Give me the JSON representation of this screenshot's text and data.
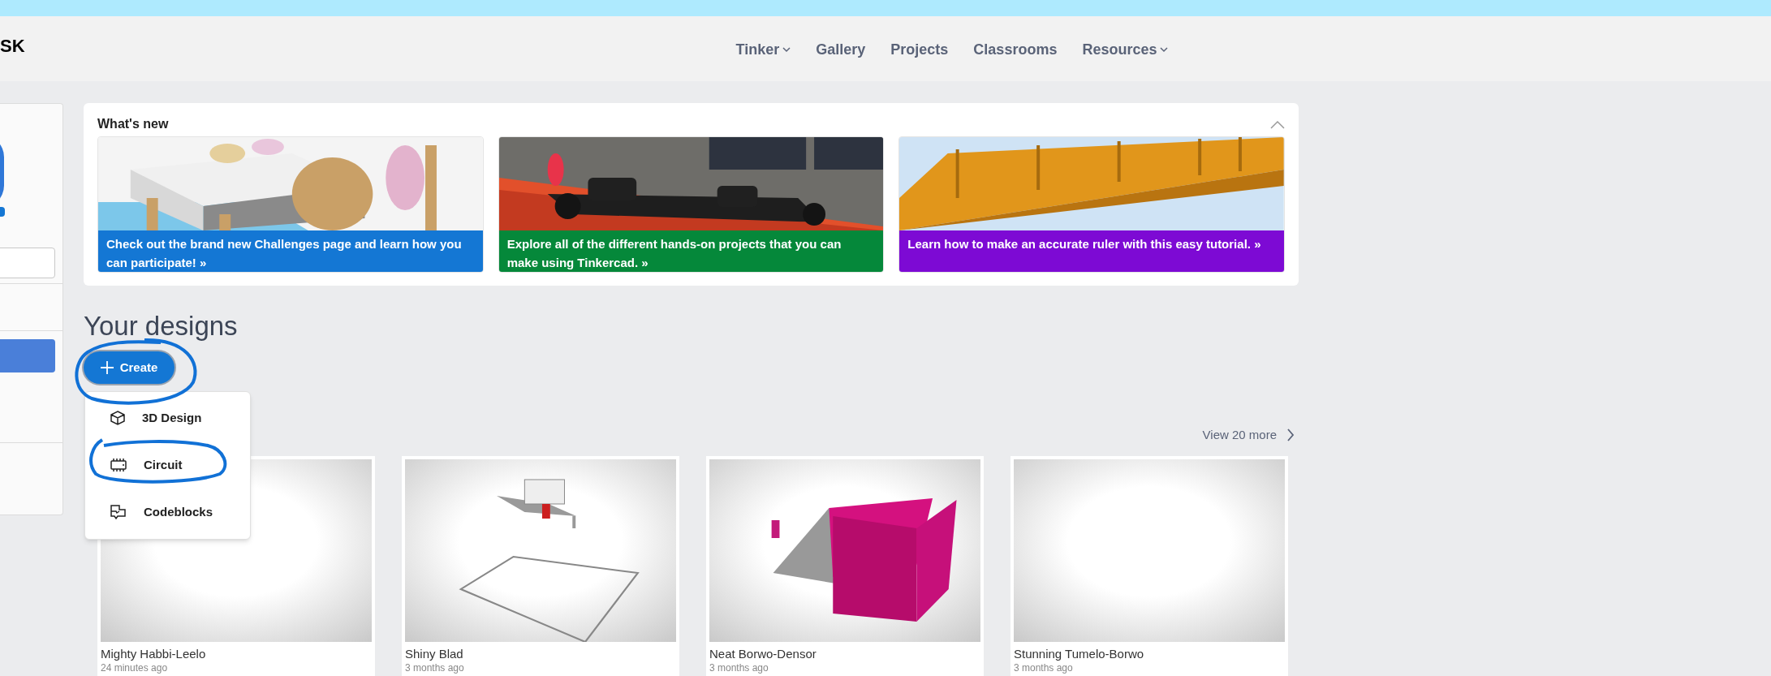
{
  "header": {
    "logo": "SK",
    "nav": [
      {
        "label": "Tinker",
        "dropdown": true
      },
      {
        "label": "Gallery",
        "dropdown": false
      },
      {
        "label": "Projects",
        "dropdown": false
      },
      {
        "label": "Classrooms",
        "dropdown": false
      },
      {
        "label": "Resources",
        "dropdown": true
      }
    ]
  },
  "whats_new": {
    "title": "What's new",
    "expanded": true,
    "cards": [
      {
        "caption": "Check out the brand new Challenges page and learn how you can participate! »",
        "color": "#1477d4"
      },
      {
        "caption": "Explore all of the different hands-on projects that you can make using Tinkercad. »",
        "color": "#05883a"
      },
      {
        "caption": "Learn how to make an accurate ruler with this easy tutorial. »",
        "color": "#7d0ad4"
      }
    ]
  },
  "designs": {
    "title": "Your designs",
    "create_button": "Create",
    "menu_open": true,
    "menu": [
      {
        "label": "3D Design",
        "kind": "cube"
      },
      {
        "label": "Circuit",
        "kind": "chip"
      },
      {
        "label": "Codeblocks",
        "kind": "blocks"
      }
    ],
    "view_more": "View 20 more",
    "items": [
      {
        "name": "Mighty Habbi-Leelo",
        "time": "24 minutes ago"
      },
      {
        "name": "Shiny Blad",
        "time": "3 months ago"
      },
      {
        "name": "Neat Borwo-Densor",
        "time": "3 months ago"
      },
      {
        "name": "Stunning Tumelo-Borwo",
        "time": "3 months ago"
      }
    ]
  }
}
